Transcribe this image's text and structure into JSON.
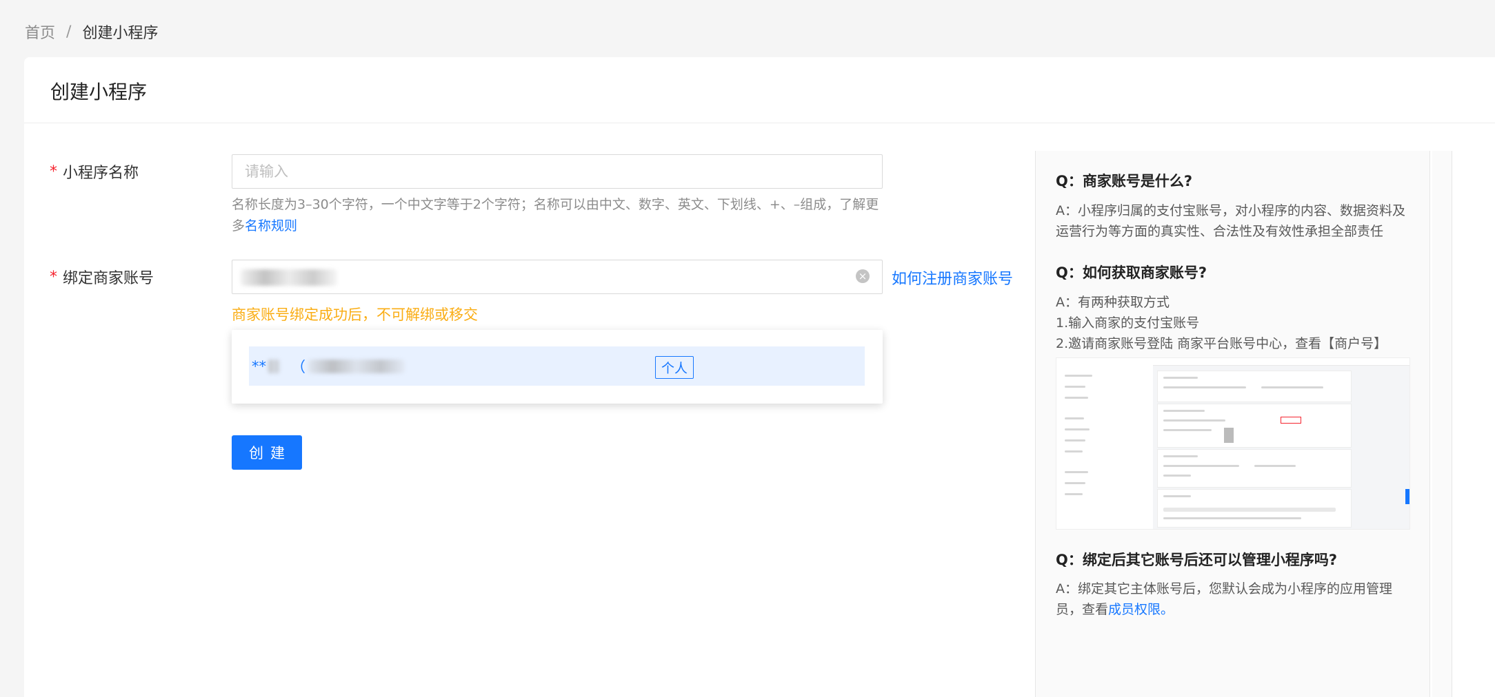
{
  "breadcrumb": {
    "home": "首页",
    "separator": "/",
    "current": "创建小程序"
  },
  "page": {
    "title": "创建小程序"
  },
  "form": {
    "required_mark": "*",
    "name": {
      "label": "小程序名称",
      "placeholder": "请输入",
      "value": "",
      "help_prefix": "名称长度为3–30个字符，一个中文字等于2个字符；名称可以由中文、数字、英文、下划线、+、–组成，了解更多",
      "help_link": "名称规则"
    },
    "merchant": {
      "label": "绑定商家账号",
      "clear_icon": "clear-circle-icon",
      "register_link": "如何注册商家账号",
      "warning": "商家账号绑定成功后，不可解绑或移交"
    },
    "dropdown": {
      "option_masked": "**",
      "option_paren": "（",
      "option_tag": "个人"
    },
    "submit_label": "创建"
  },
  "faq": [
    {
      "q": "Q：商家账号是什么?",
      "a": [
        "A：小程序归属的支付宝账号，对小程序的内容、数据资料及运营行为等方面的真实性、合法性及有效性承担全部责任"
      ]
    },
    {
      "q": "Q：如何获取商家账号?",
      "a": [
        "A：有两种获取方式",
        "1.输入商家的支付宝账号",
        "2.邀请商家账号登陆 商家平台账号中心，查看【商户号】"
      ]
    },
    {
      "q": "Q：绑定后其它账号后还可以管理小程序吗?",
      "a_prefix": "A：绑定其它主体账号后，您默认会成为小程序的应用管理员，查看",
      "a_link": "成员权限。"
    }
  ],
  "colors": {
    "primary": "#1677ff",
    "warning": "#faad14",
    "required": "#f5222d"
  }
}
